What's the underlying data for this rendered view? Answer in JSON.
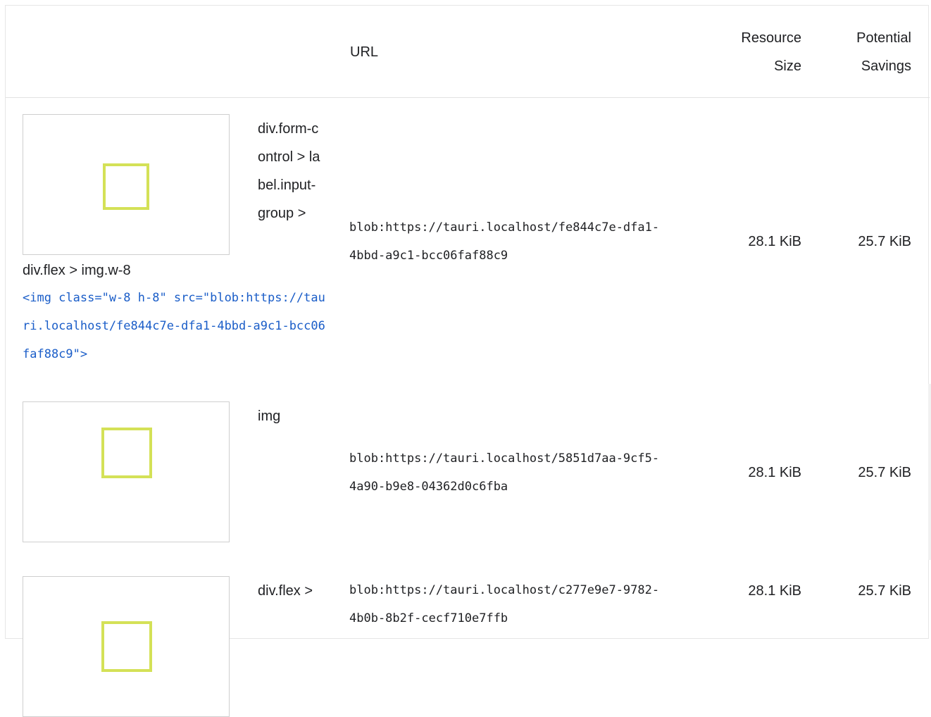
{
  "table": {
    "headers": {
      "url": "URL",
      "resource_size": "Resource Size",
      "potential_savings": "Potential Savings"
    },
    "rows": [
      {
        "selector": "div.form-control > label.input-group >",
        "path": "div.flex > img.w-8",
        "snippet": "<img class=\"w-8 h-8\" src=\"blob:https://tauri.localhost/fe844c7e-dfa1-4bbd-a9c1-bcc06faf88c9\">",
        "url": "blob:https://tauri.localhost/fe844c7e-dfa1-4bbd-a9c1-bcc06faf88c9",
        "resource_size": "28.1 KiB",
        "potential_savings": "25.7 KiB",
        "thumbnail_icon": "square-outline-icon",
        "thumbnail_color": "#d4e157"
      },
      {
        "selector": "img",
        "url": "blob:https://tauri.localhost/5851d7aa-9cf5-4a90-b9e8-04362d0c6fba",
        "resource_size": "28.1 KiB",
        "potential_savings": "25.7 KiB",
        "thumbnail_icon": "square-outline-icon",
        "thumbnail_color": "#d4e157"
      },
      {
        "selector": "div.flex >",
        "url": "blob:https://tauri.localhost/c277e9e7-9782-4b0b-8b2f-cecf710e7ffb",
        "resource_size": "28.1 KiB",
        "potential_savings": "25.7 KiB",
        "thumbnail_icon": "square-outline-icon",
        "thumbnail_color": "#d4e157"
      }
    ]
  },
  "colors": {
    "snippet_link": "#1a5dc8",
    "text": "#202124",
    "border": "#e3e3e3"
  }
}
